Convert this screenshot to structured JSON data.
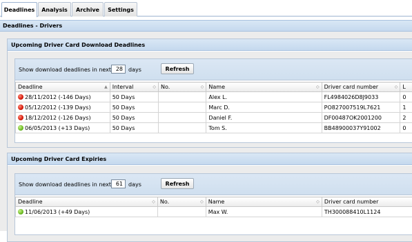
{
  "tabs": [
    {
      "label": "Deadlines",
      "active": true
    },
    {
      "label": "Analysis",
      "active": false
    },
    {
      "label": "Archive",
      "active": false
    },
    {
      "label": "Settings",
      "active": false
    }
  ],
  "page_title": "Deadlines - Drivers",
  "download_section": {
    "title": "Upcoming Driver Card Download Deadlines",
    "filter_label": "Show download deadlines in next:",
    "days_value": "28",
    "days_unit": "days",
    "refresh_label": "Refresh",
    "columns": [
      "Deadline",
      "Interval",
      "No.",
      "Name",
      "Driver card number",
      "L"
    ],
    "rows": [
      {
        "status": "red",
        "deadline": "28/11/2012 (-146 Days)",
        "interval": "50 Days",
        "no": "",
        "name": "Alex L.",
        "card": "FL4984026D8J9033",
        "last": "0"
      },
      {
        "status": "red",
        "deadline": "05/12/2012 (-139 Days)",
        "interval": "50 Days",
        "no": "",
        "name": "Marc D.",
        "card": "PO827007519L7621",
        "last": "1"
      },
      {
        "status": "red",
        "deadline": "18/12/2012 (-126 Days)",
        "interval": "50 Days",
        "no": "",
        "name": "Daniel F.",
        "card": "DF00487OK2001200",
        "last": "2"
      },
      {
        "status": "green",
        "deadline": "06/05/2013 (+13 Days)",
        "interval": "50 Days",
        "no": "",
        "name": "Tom S.",
        "card": "BB48900037Y91002",
        "last": "0"
      }
    ]
  },
  "expiry_section": {
    "title": "Upcoming Driver Card Expiries",
    "filter_label": "Show download deadlines in next:",
    "days_value": "61",
    "days_unit": "days",
    "refresh_label": "Refresh",
    "columns": [
      "Deadline",
      "No.",
      "Name",
      "Driver card number"
    ],
    "rows": [
      {
        "status": "green",
        "deadline": "11/06/2013 (+49 Days)",
        "no": "",
        "name": "Max W.",
        "card": "TH300088410L1124"
      }
    ]
  },
  "colors": {
    "red_status": "#d51a0a",
    "green_status": "#6dbb24",
    "header_blue": "#c5d9ee"
  },
  "icons": {
    "sort": "sort-arrows-icon",
    "status": "status-dot-icon"
  }
}
